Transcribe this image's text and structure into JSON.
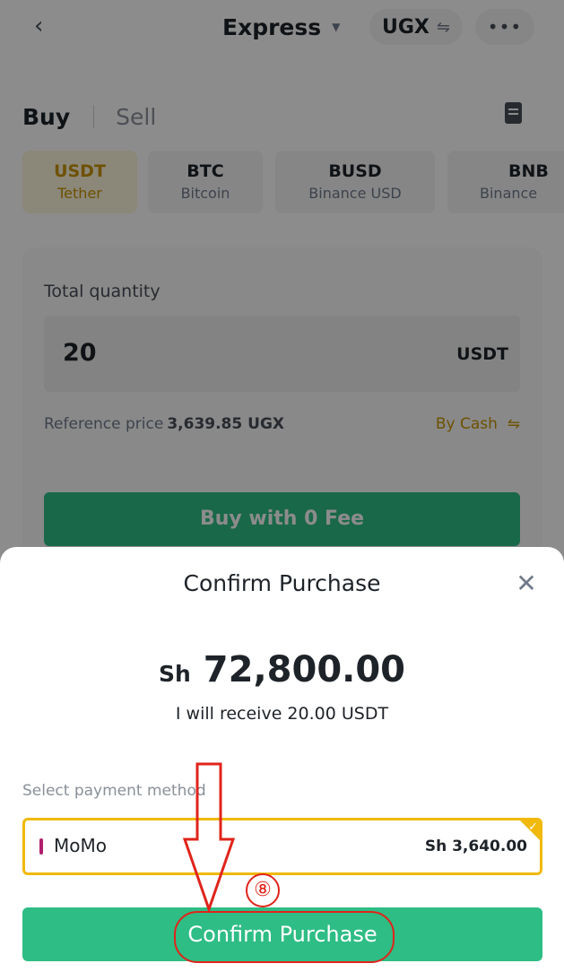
{
  "header": {
    "back_icon": "chevron-left-icon",
    "title": "Express",
    "currency": "UGX",
    "swap_icon": "swap-icon",
    "more_icon": "more-dots-icon"
  },
  "trade_tabs": {
    "buy": "Buy",
    "sell": "Sell",
    "orders_icon": "document-icon"
  },
  "coins": [
    {
      "symbol": "USDT",
      "name": "Tether",
      "selected": true
    },
    {
      "symbol": "BTC",
      "name": "Bitcoin",
      "selected": false
    },
    {
      "symbol": "BUSD",
      "name": "Binance USD",
      "selected": false
    },
    {
      "symbol": "BNB",
      "name": "Binance",
      "selected": false
    }
  ],
  "form": {
    "total_quantity_label": "Total quantity",
    "quantity_value": "20",
    "quantity_unit": "USDT",
    "reference_label": "Reference price",
    "reference_value": "3,639.85 UGX",
    "pay_method": "By Cash",
    "buy_button": "Buy with 0 Fee"
  },
  "dialog": {
    "title": "Confirm Purchase",
    "currency_symbol": "Sh",
    "amount": "72,800.00",
    "receive_text": "I will receive 20.00 USDT",
    "payment_method_label": "Select payment method",
    "payment_option": {
      "name": "MoMo",
      "price": "Sh 3,640.00",
      "selected": true
    },
    "confirm_button": "Confirm Purchase",
    "step_badge": "⑧"
  },
  "colors": {
    "accent_yellow": "#f0b90b",
    "buy_green": "#2ebd85",
    "annotation_red": "#e0241b"
  }
}
